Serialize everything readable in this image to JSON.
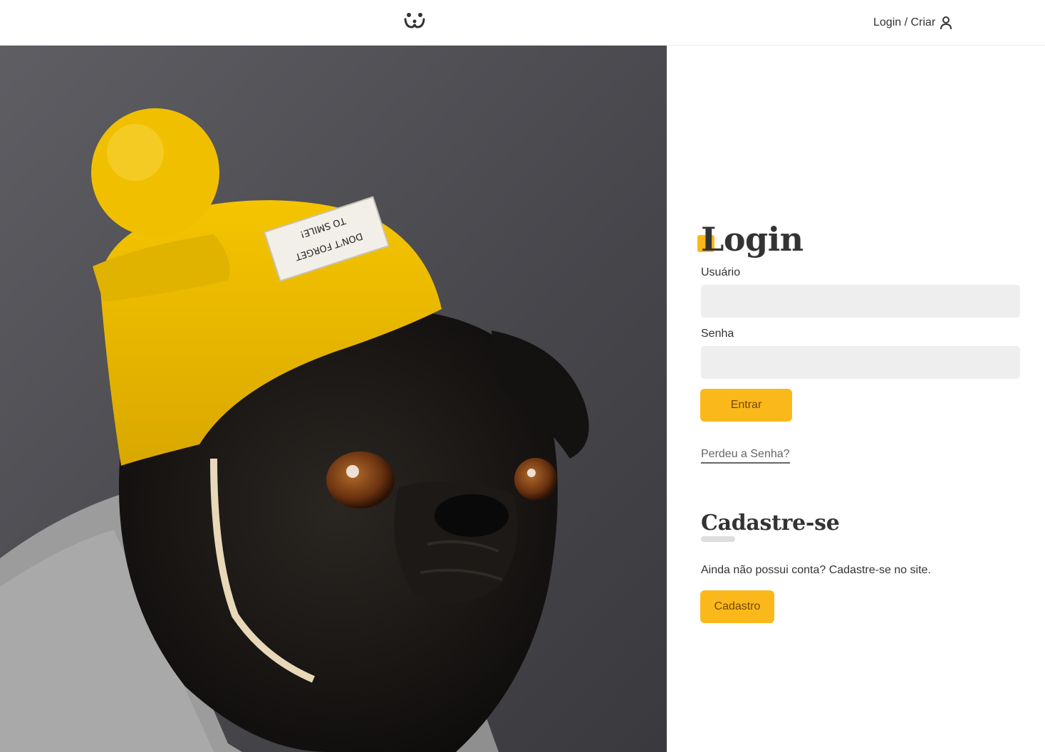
{
  "header": {
    "logo_icon": "dog-face-icon",
    "login_label": "Login / Criar",
    "user_icon": "user-icon"
  },
  "hero": {
    "image": "pug-in-yellow-beanie-photo",
    "hat_patch_text": "DON'T FORGET TO SMILE!"
  },
  "login": {
    "title": "Login",
    "username_label": "Usuário",
    "username_value": "",
    "password_label": "Senha",
    "password_value": "",
    "submit_label": "Entrar",
    "lost_password_label": "Perdeu a Senha?"
  },
  "signup": {
    "title": "Cadastre-se",
    "description": "Ainda não possui conta? Cadastre-se no site.",
    "button_label": "Cadastro"
  },
  "colors": {
    "accent": "#fbb81a",
    "accent_text": "#764701",
    "input_bg": "#eeeeee",
    "text": "#333333"
  }
}
